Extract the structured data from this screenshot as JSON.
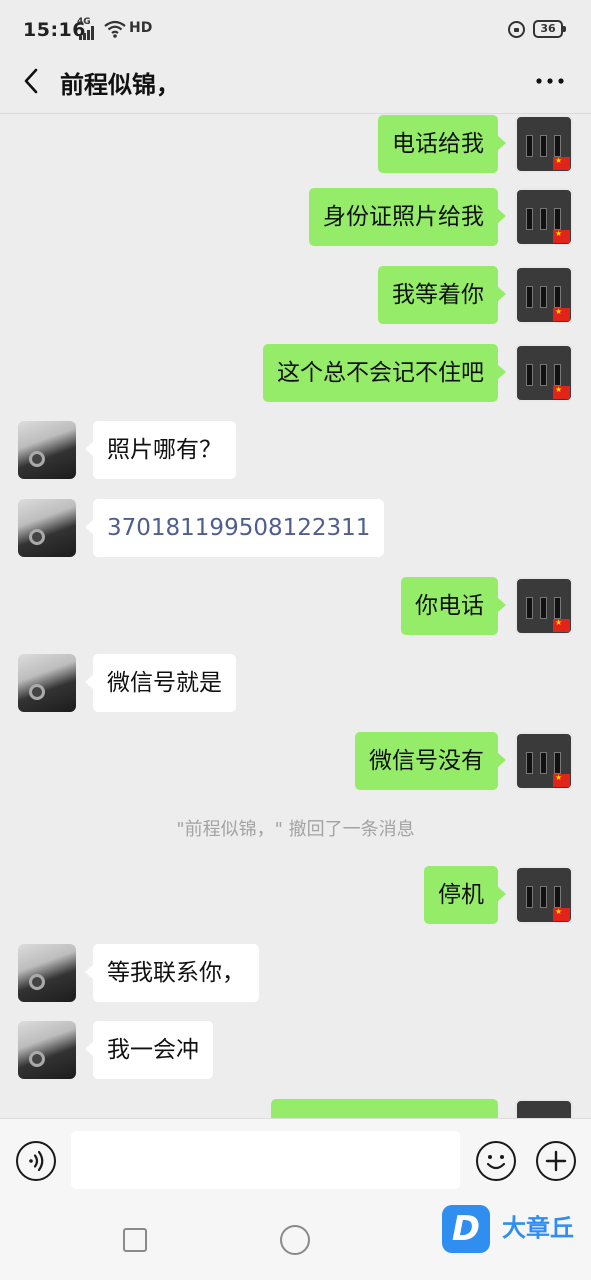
{
  "status_bar": {
    "time": "15:16",
    "network": "4G",
    "hd": "HD",
    "battery": "36"
  },
  "header": {
    "title": "前程似锦，"
  },
  "messages": [
    {
      "side": "me",
      "text": "电话给我"
    },
    {
      "side": "me",
      "text": "身份证照片给我"
    },
    {
      "side": "me",
      "text": "我等着你"
    },
    {
      "side": "me",
      "text": "这个总不会记不住吧"
    },
    {
      "side": "other",
      "text": "照片哪有？"
    },
    {
      "side": "other",
      "text": "370181199508122311"
    },
    {
      "side": "me",
      "text": "你电话"
    },
    {
      "side": "other",
      "text": "微信号就是"
    },
    {
      "side": "me",
      "text": "微信号没有"
    },
    {
      "side": "me",
      "text": "停机"
    },
    {
      "side": "other",
      "text": "等我联系你，"
    },
    {
      "side": "other",
      "text": "我一会冲"
    },
    {
      "side": "me",
      "text": ""
    }
  ],
  "recall_notice": "\"前程似锦，\" 撤回了一条消息",
  "input_bar": {
    "placeholder": ""
  },
  "watermark": {
    "logo": "D",
    "text": "大章丘"
  },
  "colors": {
    "bubble_me": "#95ec69",
    "bubble_other": "#ffffff",
    "background": "#ededed",
    "link": "#4e5f8f"
  }
}
